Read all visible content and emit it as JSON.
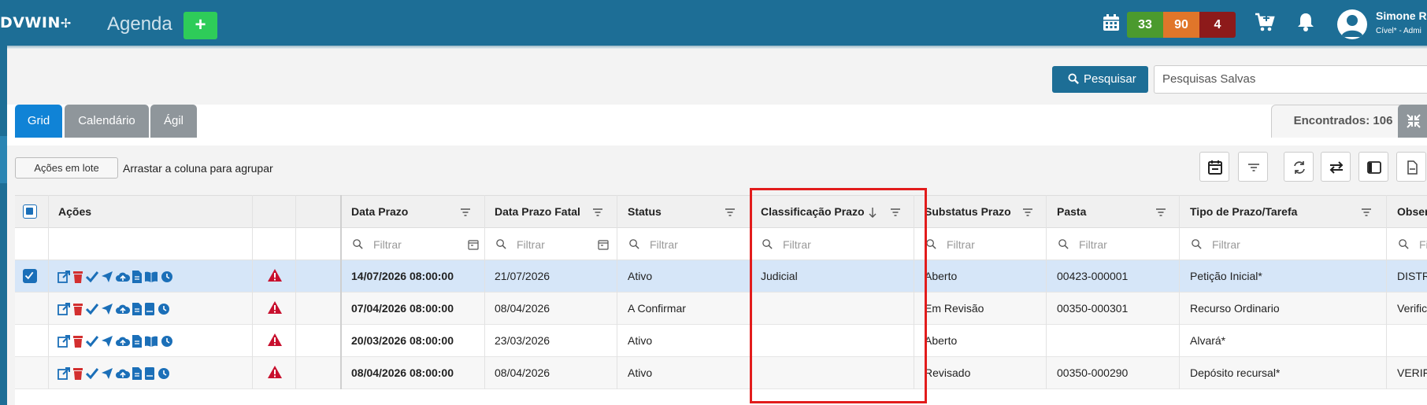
{
  "app": {
    "logo": "DVWIN",
    "title": "Agenda",
    "add_label": "+"
  },
  "header": {
    "badges": {
      "green": "33",
      "orange": "90",
      "red": "4"
    },
    "user": {
      "name": "Simone R",
      "role": "Cível* - Admi"
    },
    "icons": [
      "calendar-icon",
      "cart-icon",
      "bell-icon",
      "user-avatar-icon"
    ]
  },
  "search": {
    "button_label": "Pesquisar",
    "saved_placeholder": "Pesquisas Salvas"
  },
  "tabs": [
    {
      "label": "Grid",
      "active": true
    },
    {
      "label": "Calendário",
      "active": false
    },
    {
      "label": "Ágil",
      "active": false
    }
  ],
  "found_label": "Encontrados: 106",
  "toolbar": {
    "batch_label": "Ações em lote",
    "group_hint": "Arrastar a coluna para agrupar"
  },
  "grid": {
    "columns": {
      "acoes": "Ações",
      "data_prazo": "Data Prazo",
      "data_prazo_fatal": "Data Prazo Fatal",
      "status": "Status",
      "classificacao": "Classificação Prazo",
      "substatus": "Substatus Prazo",
      "pasta": "Pasta",
      "tipo": "Tipo de Prazo/Tarefa",
      "observ": "Observ"
    },
    "filter_placeholder": "Filtrar",
    "filter_cut": "Fil",
    "rows": [
      {
        "selected": true,
        "data_prazo": "14/07/2026 08:00:00",
        "data_fatal": "21/07/2026",
        "status": "Ativo",
        "classificacao": "Judicial",
        "substatus": "Aberto",
        "pasta": "00423-000001",
        "tipo": "Petição Inicial*",
        "observ": "DISTRI"
      },
      {
        "selected": false,
        "data_prazo": "07/04/2026 08:00:00",
        "data_fatal": "08/04/2026",
        "status": "A Confirmar",
        "classificacao": "",
        "substatus": "Em Revisão",
        "pasta": "00350-000301",
        "tipo": "Recurso Ordinario",
        "observ": "Verifica"
      },
      {
        "selected": false,
        "data_prazo": "20/03/2026 08:00:00",
        "data_fatal": "23/03/2026",
        "status": "Ativo",
        "classificacao": "",
        "substatus": "Aberto",
        "pasta": "",
        "tipo": "Alvará*",
        "observ": ""
      },
      {
        "selected": false,
        "data_prazo": "08/04/2026 08:00:00",
        "data_fatal": "08/04/2026",
        "status": "Ativo",
        "classificacao": "",
        "substatus": "Revisado",
        "pasta": "00350-000290",
        "tipo": "Depósito recursal*",
        "observ": "VERIFIC"
      }
    ]
  },
  "colors": {
    "topbar": "#1d6e96",
    "accent": "#1083d6",
    "highlight": "#e21c1c"
  }
}
